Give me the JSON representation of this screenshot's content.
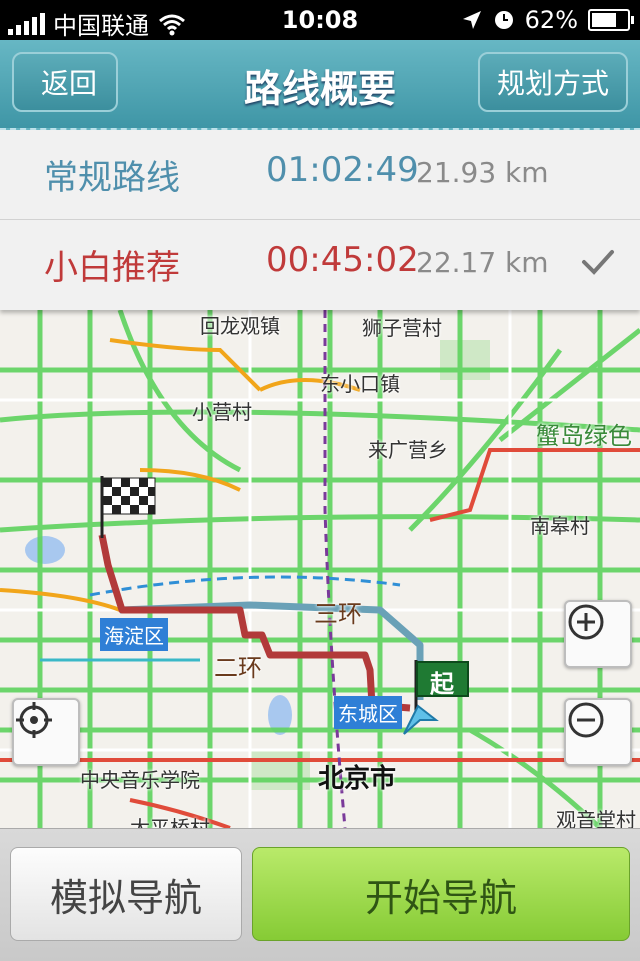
{
  "status_bar": {
    "carrier": "中国联通",
    "time": "10:08",
    "battery": "62%"
  },
  "nav": {
    "back_label": "返回",
    "title": "路线概要",
    "plan_label": "规划方式"
  },
  "routes": [
    {
      "name": "常规路线",
      "time": "01:02:49",
      "distance": "21.93 km",
      "selected": false
    },
    {
      "name": "小白推荐",
      "time": "00:45:02",
      "distance": "22.17 km",
      "selected": true
    }
  ],
  "map": {
    "labels": {
      "huilongguan": "回龙观镇",
      "shiziying": "狮子营村",
      "dongxiaokou": "东小口镇",
      "xiaoying": "小营村",
      "laiguangying": "来广营乡",
      "pandao": "蟹岛绿色",
      "nangaocun": "南皋村",
      "haidian": "海淀区",
      "sanhuan": "三环",
      "erhuan": "二环",
      "dongcheng": "东城区",
      "conservatory": "中央音乐学院",
      "beijing": "北京市",
      "taipingqiao": "太平桥村",
      "guanyintang": "观音堂村",
      "start_flag": "起"
    },
    "colors": {
      "route": "#b23a3a",
      "alt_route": "#6aa1b7",
      "traffic_green": "#5ed35e",
      "traffic_orange": "#f1a51a"
    }
  },
  "bottom": {
    "simulate_label": "模拟导航",
    "start_label": "开始导航"
  }
}
